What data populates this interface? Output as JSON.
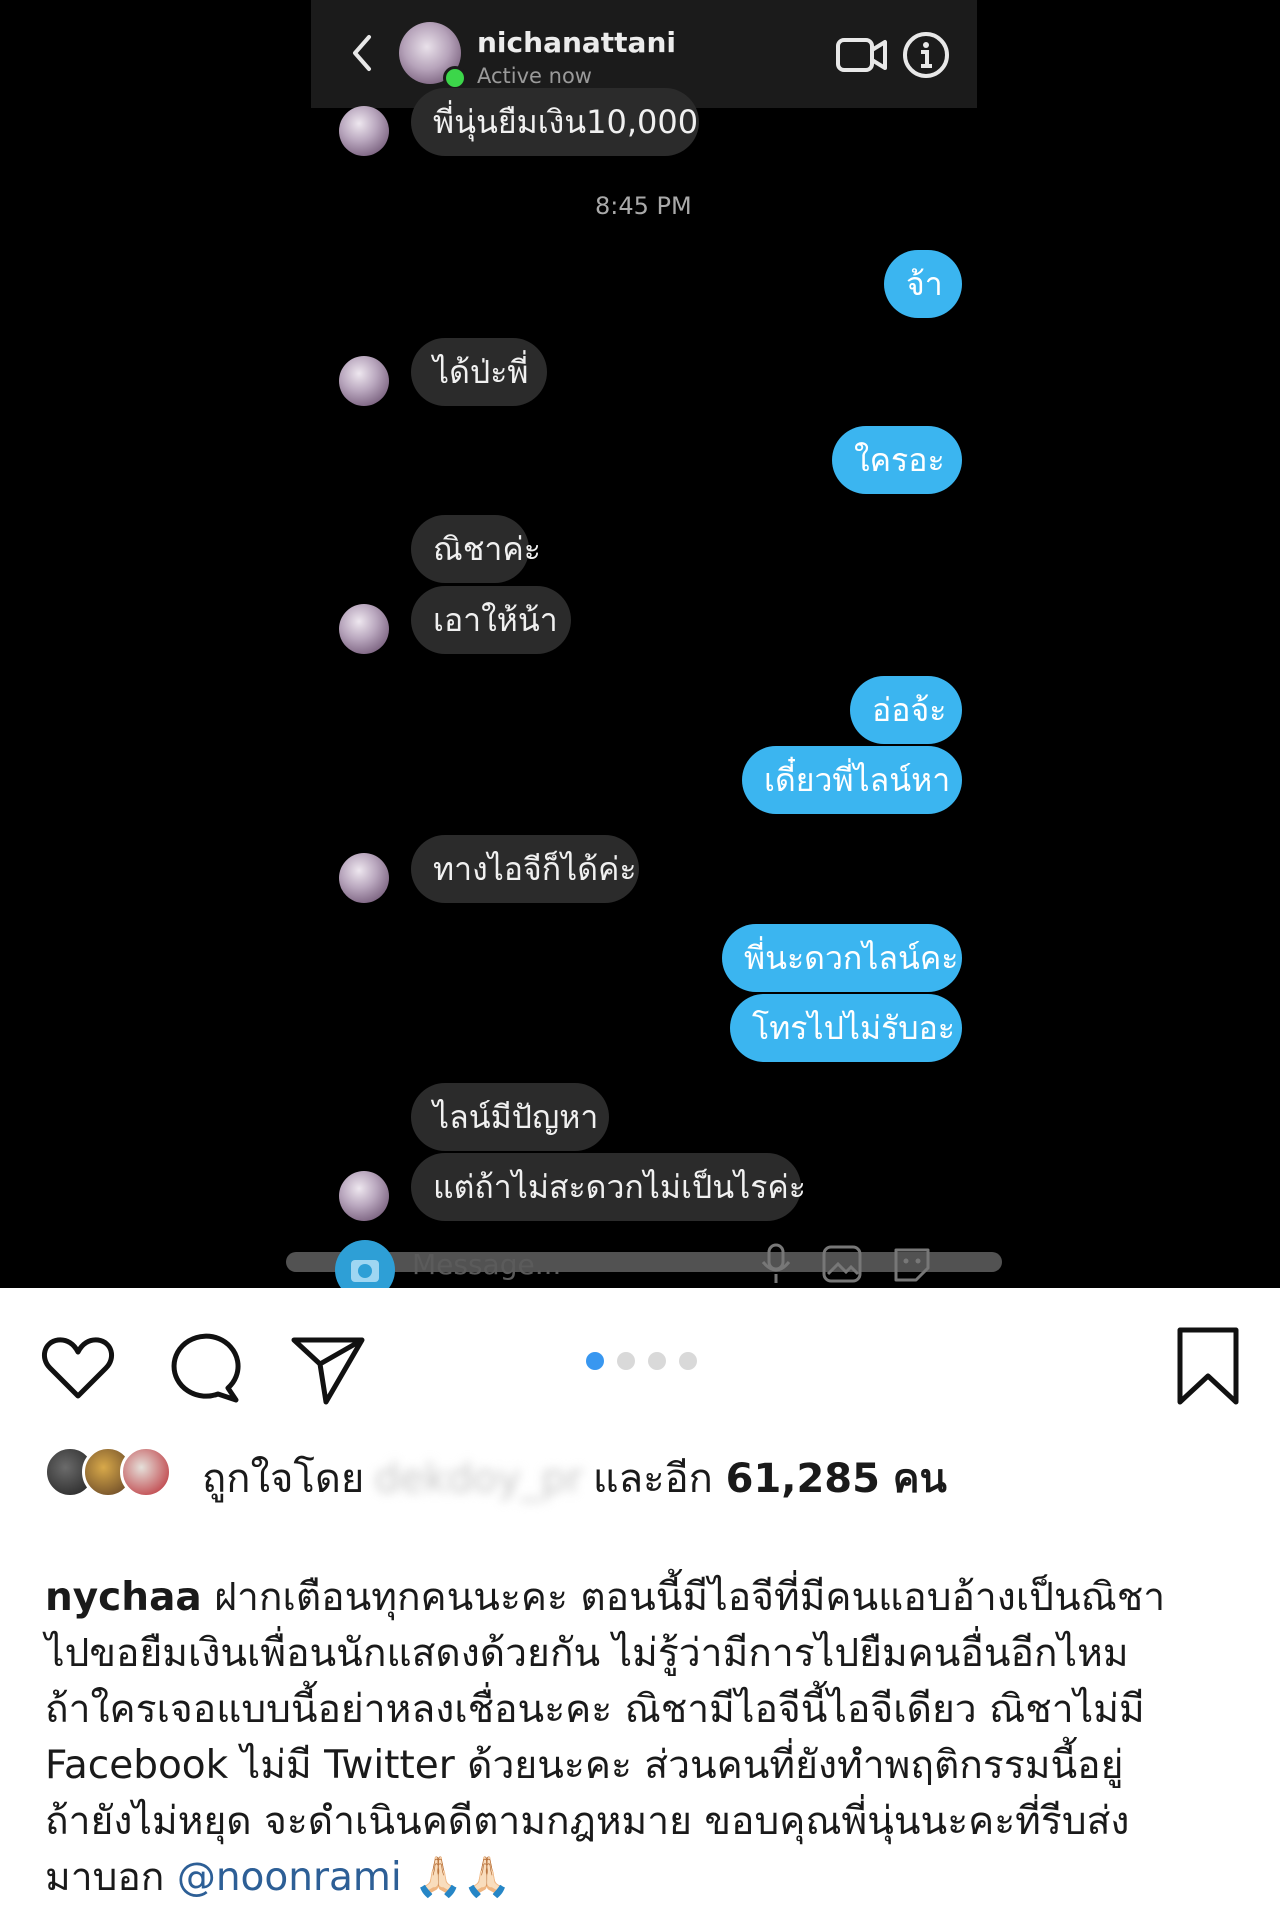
{
  "dm": {
    "username": "nichanattani",
    "status": "Active now",
    "timestamp": "8:45 PM",
    "messages": [
      {
        "side": "in",
        "text": "พี่นุ่นยืมเงิน10,000"
      },
      {
        "side": "out",
        "text": "จ้า"
      },
      {
        "side": "in",
        "text": "ได้ป่ะพี่"
      },
      {
        "side": "out",
        "text": "ใครอะ"
      },
      {
        "side": "in",
        "text": "ณิชาค่ะ"
      },
      {
        "side": "in",
        "text": "เอาให้น้า"
      },
      {
        "side": "out",
        "text": "อ่อจ้ะ"
      },
      {
        "side": "out",
        "text": "เดี๋ยวพี่ไลน์หา"
      },
      {
        "side": "in",
        "text": "ทางไอจีก็ได้ค่ะ"
      },
      {
        "side": "out",
        "text": "พี่นะดวกไลน์คะ"
      },
      {
        "side": "out",
        "text": "โทรไปไม่รับอะ"
      },
      {
        "side": "in",
        "text": "ไลน์มีปัญหา"
      },
      {
        "side": "in",
        "text": "แต่ถ้าไม่สะดวกไม่เป็นไรค่ะ"
      }
    ],
    "composer_placeholder": "Message...",
    "icons": {
      "back": "chevron-left-icon",
      "video": "video-camera-icon",
      "info": "info-icon",
      "camera": "camera-icon",
      "mic": "microphone-icon",
      "gallery": "gallery-icon",
      "sticker": "sticker-icon"
    },
    "colors": {
      "outgoing": "#3bb5f0",
      "incoming": "#2b2b2b",
      "active": "#3cd64a"
    }
  },
  "post": {
    "actions": [
      "heart-icon",
      "comment-icon",
      "share-icon",
      "bookmark-icon"
    ],
    "carousel": {
      "count": 4,
      "active_index": 0
    },
    "likes": {
      "prefix": "ถูกใจโดย",
      "blurred_user": "dekdoy_pr",
      "middle": "และอีก",
      "count": "61,285",
      "suffix": "คน"
    },
    "caption": {
      "username": "nychaa",
      "lines": [
        "ฝากเตือนทุกคนนะคะ ตอนนี้มีไอจีที่มีคนแอบอ้างเป็นณิชา",
        "ไปขอยืมเงินเพื่อนนักแสดงด้วยกัน ไม่รู้ว่ามีการไปยืมคนอื่นอีกไหม",
        "ถ้าใครเจอแบบนี้อย่าหลงเชื่อนะคะ ณิชามีไอจีนี้ไอจีเดียว ณิชาไม่มี",
        "Facebook ไม่มี Twitter ด้วยนะคะ ส่วนคนที่ยังทำพฤติกรรมนี้อยู่",
        "ถ้ายังไม่หยุด จะดำเนินคดีตามกฎหมาย ขอบคุณพี่นุ่นนะคะที่รีบส่ง"
      ],
      "last_prefix": "มาบอก",
      "mention": "@noonrami",
      "emoji": "🙏🏻🙏🏻"
    },
    "colors": {
      "dot_active": "#3897f0",
      "mention": "#2d5f96"
    }
  }
}
